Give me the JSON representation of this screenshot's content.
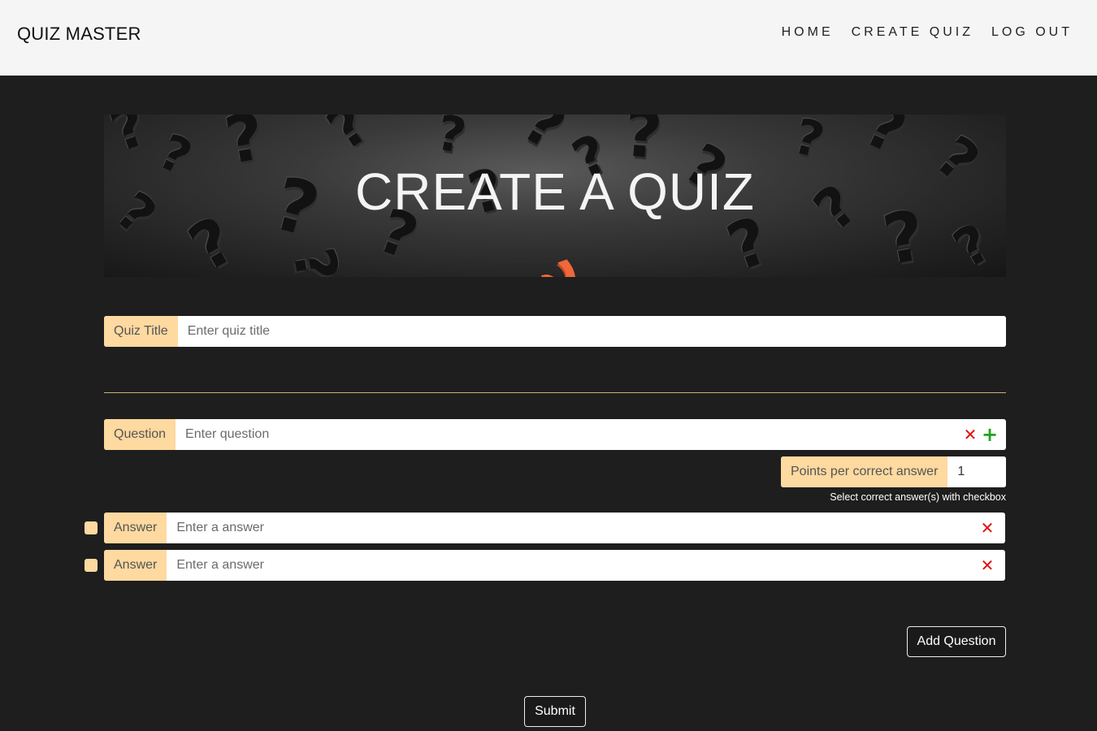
{
  "nav": {
    "brand": "QUIZ MASTER",
    "links": [
      "HOME",
      "CREATE QUIZ",
      "LOG OUT"
    ]
  },
  "hero": {
    "title": "CREATE A QUIZ"
  },
  "quiz_title": {
    "label": "Quiz Title",
    "placeholder": "Enter quiz title"
  },
  "question": {
    "label": "Question",
    "placeholder": "Enter question",
    "points_label": "Points per correct answer",
    "points_value": "1",
    "hint": "Select correct answer(s) with checkbox",
    "answers": [
      {
        "label": "Answer",
        "placeholder": "Enter a answer"
      },
      {
        "label": "Answer",
        "placeholder": "Enter a answer"
      }
    ]
  },
  "buttons": {
    "add_question": "Add Question",
    "submit": "Submit"
  },
  "colors": {
    "accent": "#fed9a0",
    "background": "#1e1e1e",
    "remove": "#e01010",
    "add": "#1fa31f"
  },
  "icons": {
    "remove": "close-icon",
    "add": "plus-icon"
  }
}
